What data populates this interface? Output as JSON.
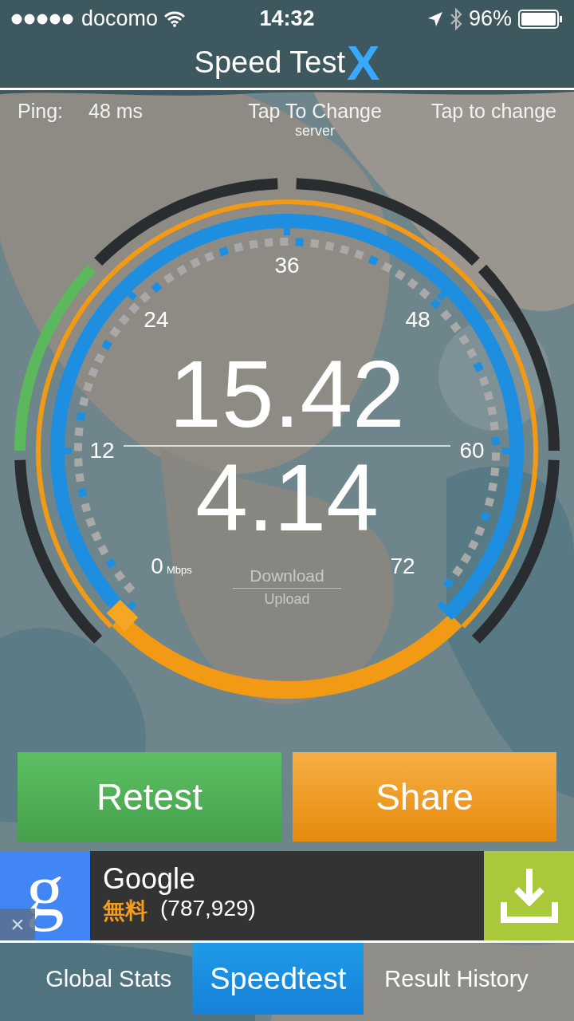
{
  "status_bar": {
    "carrier": "docomo",
    "time": "14:32",
    "battery": "96%"
  },
  "header": {
    "title": "Speed Test",
    "logo_letter": "X"
  },
  "info": {
    "ping_label": "Ping:",
    "ping_value": "48 ms",
    "server_title": "Tap To Change",
    "server_subtitle": "server",
    "right_link": "Tap to change"
  },
  "gauge": {
    "scale": [
      {
        "label": "0",
        "unit": "Mbps"
      },
      {
        "label": "12"
      },
      {
        "label": "24"
      },
      {
        "label": "36"
      },
      {
        "label": "48"
      },
      {
        "label": "60"
      },
      {
        "label": "72"
      }
    ],
    "download_value": "15.42",
    "upload_value": "4.14",
    "download_label": "Download",
    "upload_label": "Upload"
  },
  "buttons": [
    {
      "label": "Retest",
      "kind": "retest"
    },
    {
      "label": "Share",
      "kind": "share"
    }
  ],
  "ad": {
    "logo": "g",
    "close": "×",
    "title": "Google",
    "price": "無料",
    "count": "(787,929)"
  },
  "tabs": [
    {
      "label": "Global Stats",
      "selected": false
    },
    {
      "label": "Speedtest",
      "selected": true
    },
    {
      "label": "Result History",
      "selected": false
    }
  ]
}
